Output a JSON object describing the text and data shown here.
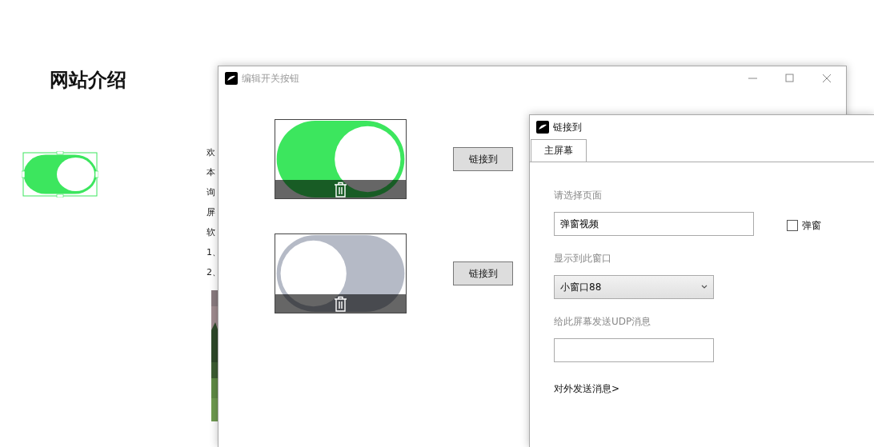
{
  "page": {
    "heading": "网站介绍",
    "switch": {
      "on": true
    },
    "clipped_lines": [
      "欢",
      "本",
      "询",
      "屏",
      "软",
      "1、",
      "2、"
    ]
  },
  "editor_window": {
    "title": "编辑开关按钮",
    "switches": [
      {
        "on": true,
        "link_button": "链接到"
      },
      {
        "on": false,
        "link_button": "链接到"
      }
    ]
  },
  "link_dialog": {
    "title": "链接到",
    "tabs": [
      {
        "label": "主屏幕",
        "selected": true
      }
    ],
    "page_label": "请选择页面",
    "page_field": {
      "value": "弹窗视频"
    },
    "popup_checkbox": {
      "label": "弹窗",
      "checked": false
    },
    "window_label": "显示到此窗口",
    "window_select": {
      "value": "小窗口88"
    },
    "udp_label": "给此屏幕发送UDP消息",
    "send_link": "对外发送消息>"
  }
}
